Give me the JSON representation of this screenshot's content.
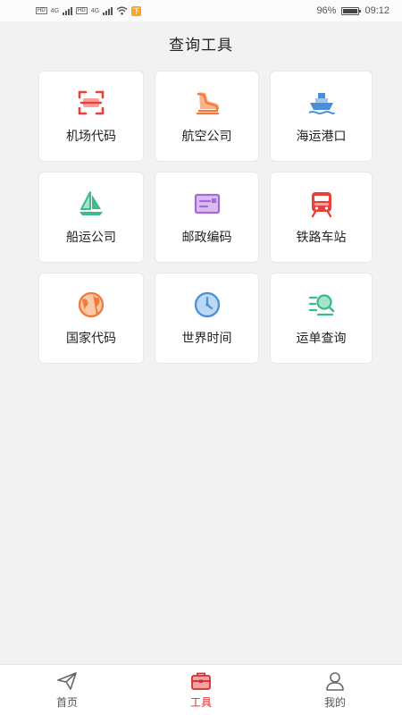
{
  "status_bar": {
    "network_badge_1": "HD",
    "network_badge_2": "HD",
    "network_gen_1": "4G",
    "network_gen_2": "4G",
    "battery": "96%",
    "time": "09:12",
    "notice_glyph": "下"
  },
  "page": {
    "title": "查询工具"
  },
  "tools": [
    {
      "label": "机场代码",
      "icon": "airport-scan-icon",
      "color": "#e8413c"
    },
    {
      "label": "航空公司",
      "icon": "airline-boot-icon",
      "color": "#f07a3a"
    },
    {
      "label": "海运港口",
      "icon": "ship-icon",
      "color": "#4a90d9"
    },
    {
      "label": "船运公司",
      "icon": "sailboat-icon",
      "color": "#3dbb8a"
    },
    {
      "label": "邮政编码",
      "icon": "postal-card-icon",
      "color": "#a36bd6"
    },
    {
      "label": "铁路车站",
      "icon": "train-icon",
      "color": "#e8413c"
    },
    {
      "label": "国家代码",
      "icon": "globe-icon",
      "color": "#f07a3a"
    },
    {
      "label": "世界时间",
      "icon": "clock-icon",
      "color": "#4a90d9"
    },
    {
      "label": "运单查询",
      "icon": "search-list-icon",
      "color": "#3dbb8a"
    }
  ],
  "tab_bar": {
    "items": [
      {
        "label": "首页",
        "icon": "paper-plane-icon",
        "active": false
      },
      {
        "label": "工具",
        "icon": "toolbox-icon",
        "active": true
      },
      {
        "label": "我的",
        "icon": "user-icon",
        "active": false
      }
    ],
    "active_color": "#d92b2b"
  }
}
